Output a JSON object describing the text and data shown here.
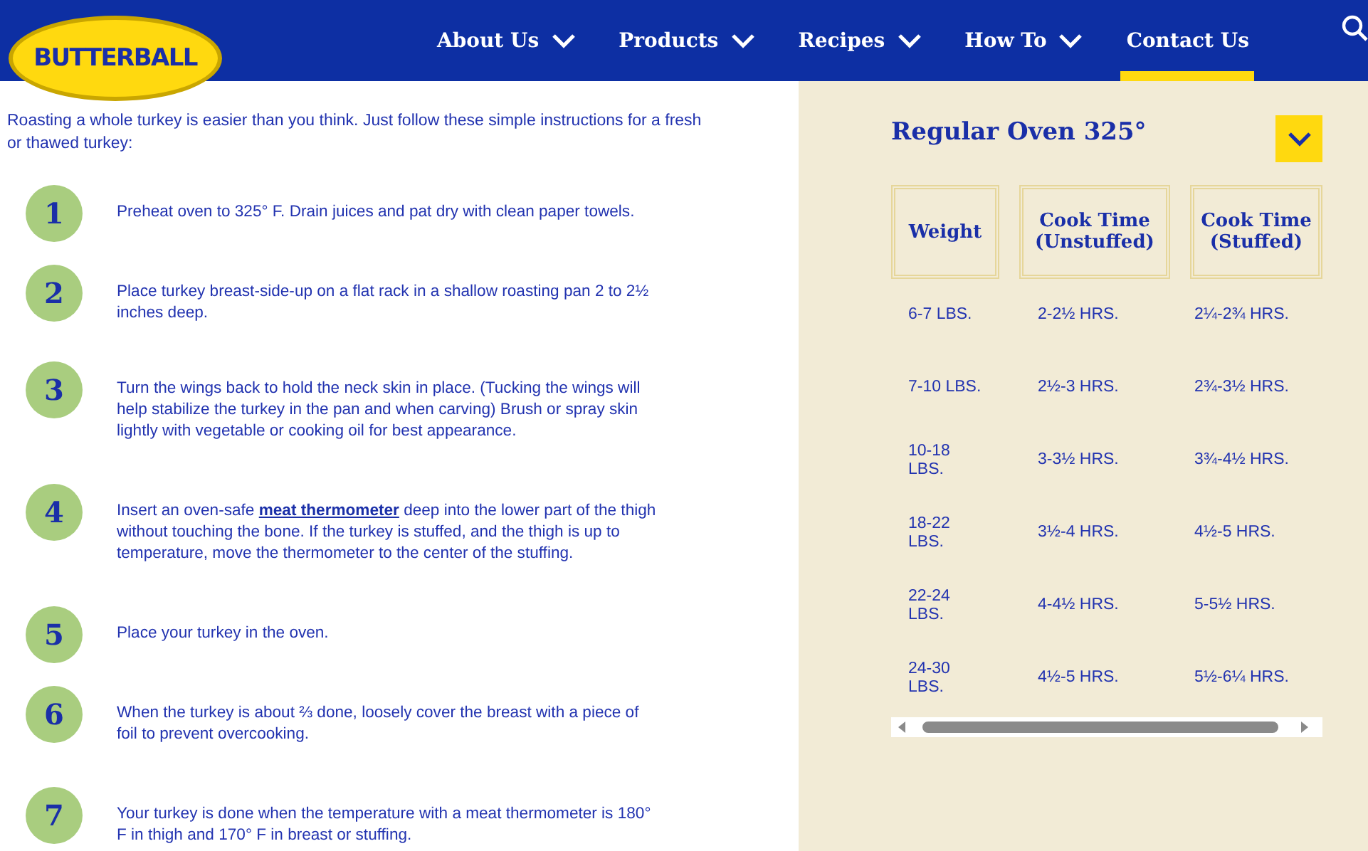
{
  "logo": {
    "text": "BUTTERBALL"
  },
  "nav": [
    {
      "label": "About Us",
      "dropdown": true,
      "selected": false
    },
    {
      "label": "Products",
      "dropdown": true,
      "selected": false
    },
    {
      "label": "Recipes",
      "dropdown": true,
      "selected": false
    },
    {
      "label": "How To",
      "dropdown": true,
      "selected": false
    },
    {
      "label": "Contact Us",
      "dropdown": false,
      "selected": true
    }
  ],
  "intro": "Roasting a whole turkey is easier than you think. Just follow these simple instructions for a fresh or thawed turkey:",
  "steps": [
    {
      "number": "1",
      "text": "Preheat oven to 325° F. Drain juices and pat dry with clean paper towels."
    },
    {
      "number": "2",
      "text": "Place turkey breast-side-up on a flat rack in a shallow roasting pan 2 to 2½ inches deep."
    },
    {
      "number": "3",
      "text": "Turn the wings back to hold the neck skin in place. (Tucking the wings will help stabilize the turkey in the pan and when carving) Brush or spray skin lightly with vegetable or cooking oil for best appearance."
    },
    {
      "number": "4",
      "text": "Insert an oven-safe ",
      "link": "meat thermometer",
      "text_after": " deep into the lower part of the thigh without touching the bone. If the turkey is stuffed, and the thigh is up to temperature, move the thermometer to the center of the stuffing."
    },
    {
      "number": "5",
      "text": "Place your turkey in the oven."
    },
    {
      "number": "6",
      "text": "When the turkey is about ⅔ done, loosely cover the breast with a piece of foil to prevent overcooking."
    },
    {
      "number": "7",
      "text": "Your turkey is done when the temperature with a meat thermometer is 180° F in thigh and 170° F in breast or stuffing."
    }
  ],
  "panel": {
    "title": "Regular Oven 325°",
    "expanded": true,
    "columns": [
      "Weight",
      "Cook Time (Unstuffed)",
      "Cook Time (Stuffed)"
    ],
    "rows": [
      [
        "6-7 LBS.",
        "2-2½ HRS.",
        "2¼-2¾ HRS."
      ],
      [
        "7-10 LBS.",
        "2½-3 HRS.",
        "2¾-3½ HRS."
      ],
      [
        "10-18 LBS.",
        "3-3½ HRS.",
        "3¾-4½ HRS."
      ],
      [
        "18-22 LBS.",
        "3½-4 HRS.",
        "4½-5 HRS."
      ],
      [
        "22-24 LBS.",
        "4-4½ HRS.",
        "5-5½ HRS."
      ],
      [
        "24-30 LBS.",
        "4½-5 HRS.",
        "5½-6¼ HRS."
      ]
    ]
  }
}
